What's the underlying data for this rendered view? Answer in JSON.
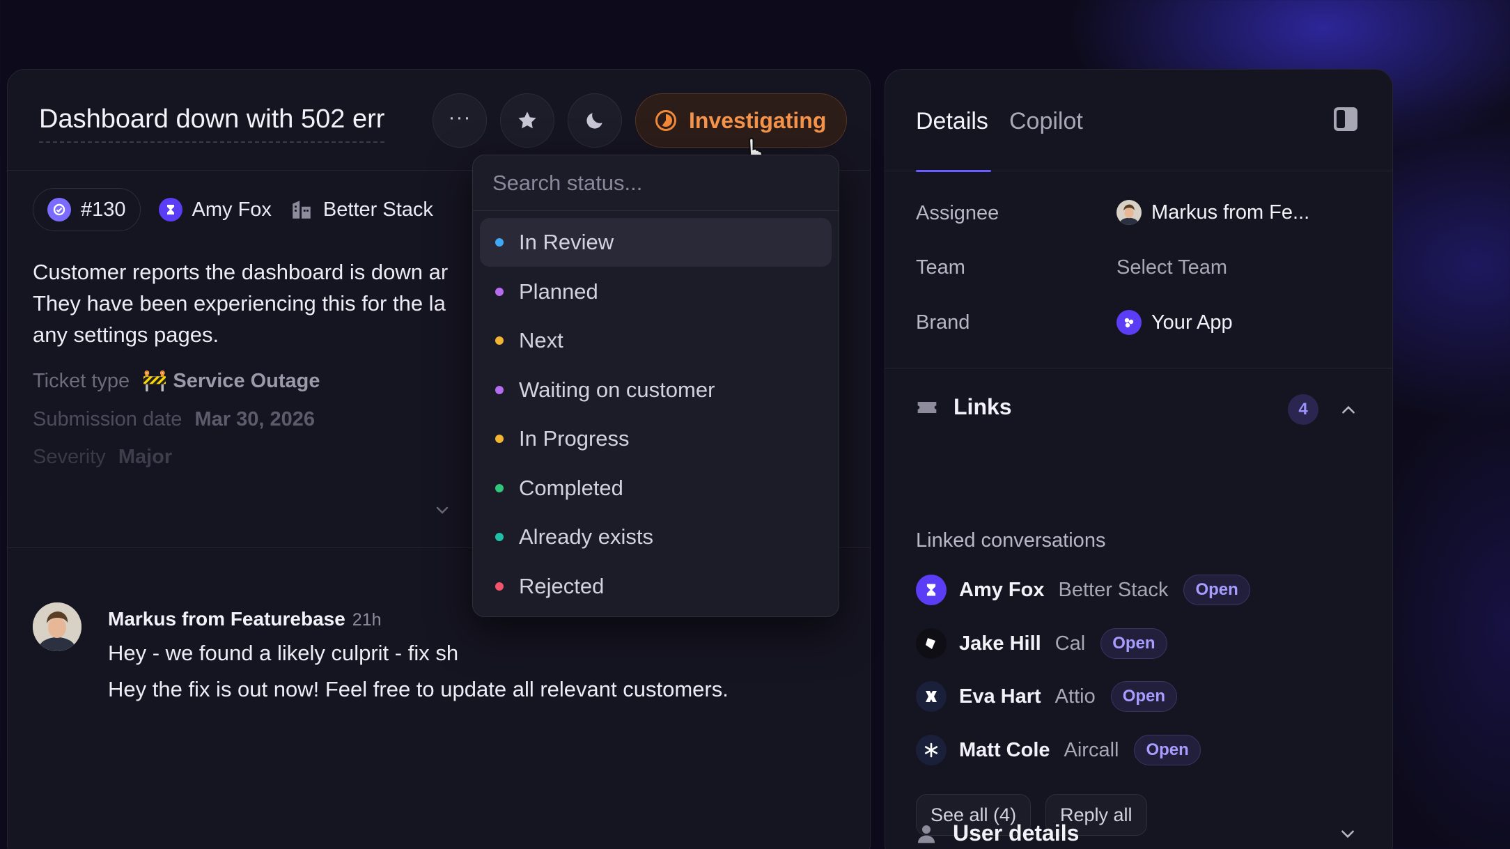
{
  "ticket": {
    "title": "Dashboard down with 502 err",
    "status_label": "Investigating",
    "number": "#130",
    "customer": "Amy Fox",
    "company": "Better Stack",
    "description_lines": [
      "Customer reports the dashboard is down ar",
      "They have been experiencing this for the la",
      "any settings pages."
    ],
    "ticket_type_label": "Ticket type",
    "ticket_type_value": "🚧 Service Outage",
    "submission_date_label": "Submission date",
    "submission_date_value": "Mar 30, 2026",
    "faded_field_label": "Severity",
    "faded_field_value": "Major"
  },
  "message": {
    "author": "Markus from Featurebase",
    "time": "21h",
    "lines": [
      "Hey - we found a likely culprit - fix sh",
      "Hey the fix is out now! Feel free to update all relevant customers."
    ]
  },
  "status_dropdown": {
    "search_placeholder": "Search status...",
    "options": [
      {
        "label": "In Review",
        "color": "#3fa9f5",
        "active": true
      },
      {
        "label": "Planned",
        "color": "#b56cf0",
        "active": false
      },
      {
        "label": "Next",
        "color": "#f2b531",
        "active": false
      },
      {
        "label": "Waiting on customer",
        "color": "#b56cf0",
        "active": false
      },
      {
        "label": "In Progress",
        "color": "#f2b531",
        "active": false
      },
      {
        "label": "Completed",
        "color": "#2fc77a",
        "active": false
      },
      {
        "label": "Already exists",
        "color": "#20c0a8",
        "active": false
      },
      {
        "label": "Rejected",
        "color": "#f2556a",
        "active": false
      }
    ]
  },
  "sidebar": {
    "tabs": [
      "Details",
      "Copilot"
    ],
    "properties": {
      "assignee_label": "Assignee",
      "assignee_value": "Markus from Fe...",
      "team_label": "Team",
      "team_value": "Select Team",
      "brand_label": "Brand",
      "brand_value": "Your App"
    },
    "links": {
      "title": "Links",
      "count": "4",
      "sub_label": "Linked conversations",
      "conversations": [
        {
          "name": "Amy Fox",
          "company": "Better Stack",
          "status": "Open",
          "icon_color": "#5b3df5"
        },
        {
          "name": "Jake Hill",
          "company": "Cal",
          "status": "Open",
          "icon_color": "#0e0e14"
        },
        {
          "name": "Eva Hart",
          "company": "Attio",
          "status": "Open",
          "icon_color": "#1a1f3a"
        },
        {
          "name": "Matt Cole",
          "company": "Aircall",
          "status": "Open",
          "icon_color": "#1a1f3a"
        }
      ],
      "see_all_label": "See all  (4)",
      "reply_all_label": "Reply all"
    },
    "user_details_title": "User details"
  },
  "colors": {
    "accent": "#6a5cff",
    "status_orange": "#f5944a"
  }
}
